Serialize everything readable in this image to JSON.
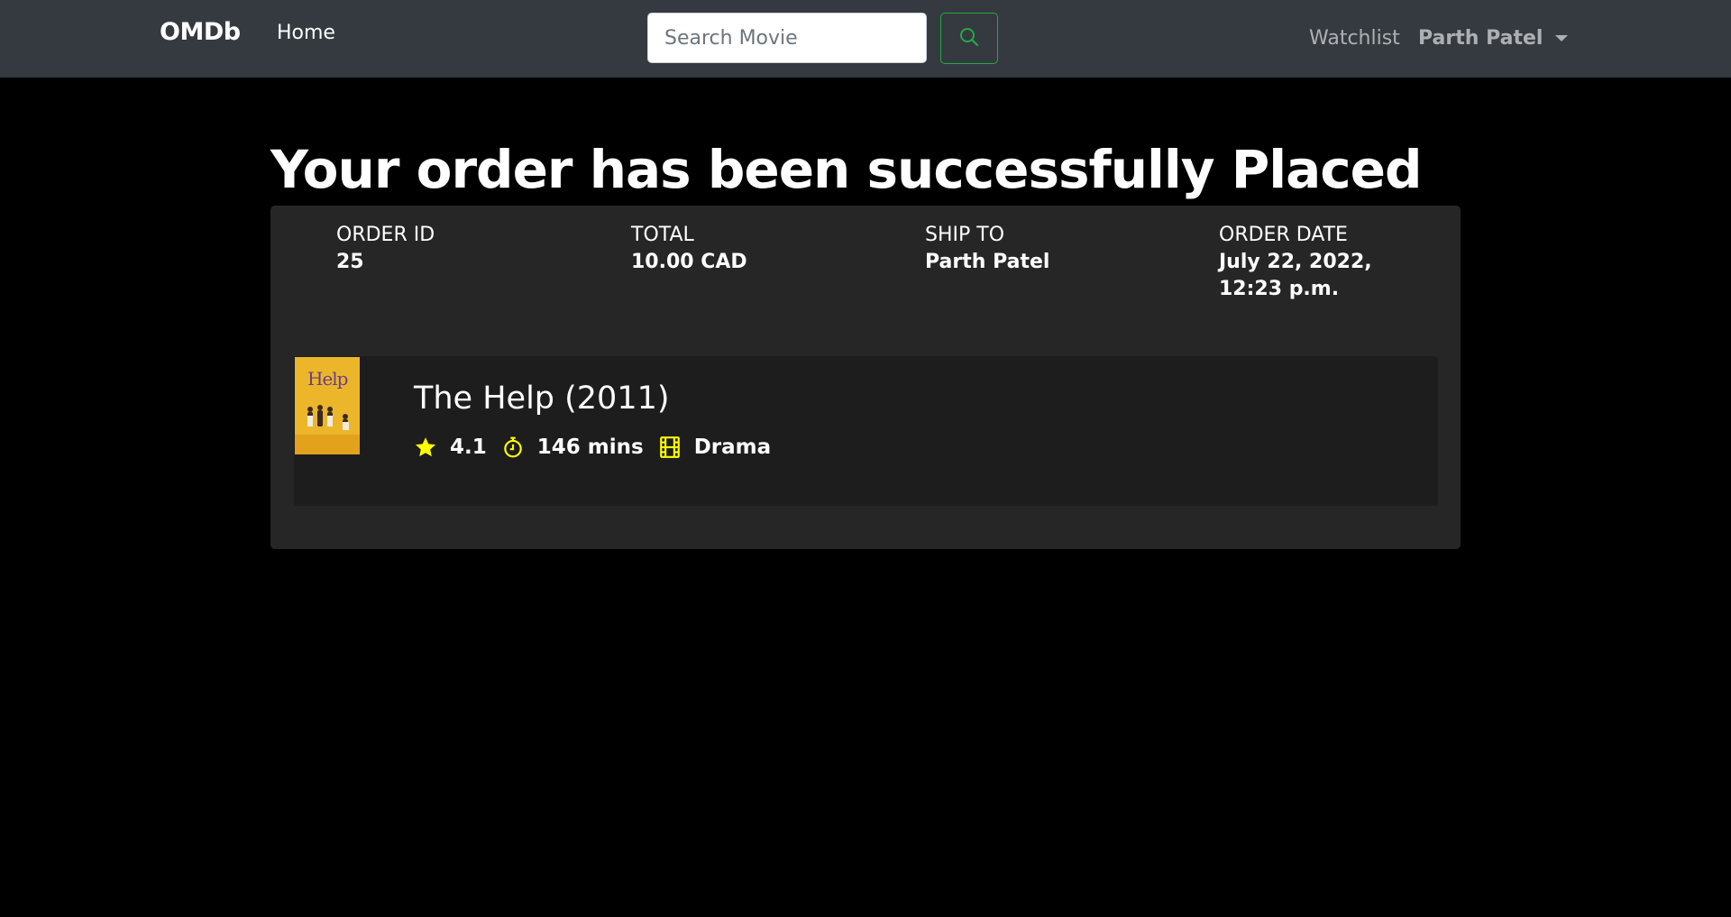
{
  "navbar": {
    "brand": "OMDb",
    "home_label": "Home",
    "search_placeholder": "Search Movie",
    "search_icon": "search-icon",
    "watchlist_label": "Watchlist",
    "user_name": "Parth Patel"
  },
  "page": {
    "title": "Your order has been successfully Placed"
  },
  "order": {
    "id_label": "ORDER ID",
    "id_value": "25",
    "total_label": "TOTAL",
    "total_value": "10.00 CAD",
    "ship_label": "SHIP TO",
    "ship_value": "Parth Patel",
    "date_label": "ORDER DATE",
    "date_value": "July 22, 2022, 12:23 p.m."
  },
  "item": {
    "poster_text": "Help",
    "title": "The Help (2011)",
    "rating": "4.1",
    "runtime": "146 mins",
    "genre": "Drama",
    "icons": [
      "star-icon",
      "stopwatch-icon",
      "film-icon"
    ]
  },
  "colors": {
    "navbar_bg": "#343a40",
    "card_bg": "#262626",
    "item_bg": "#1d1d1d",
    "accent_yellow": "#ffff00",
    "search_button_border": "#28a745"
  }
}
